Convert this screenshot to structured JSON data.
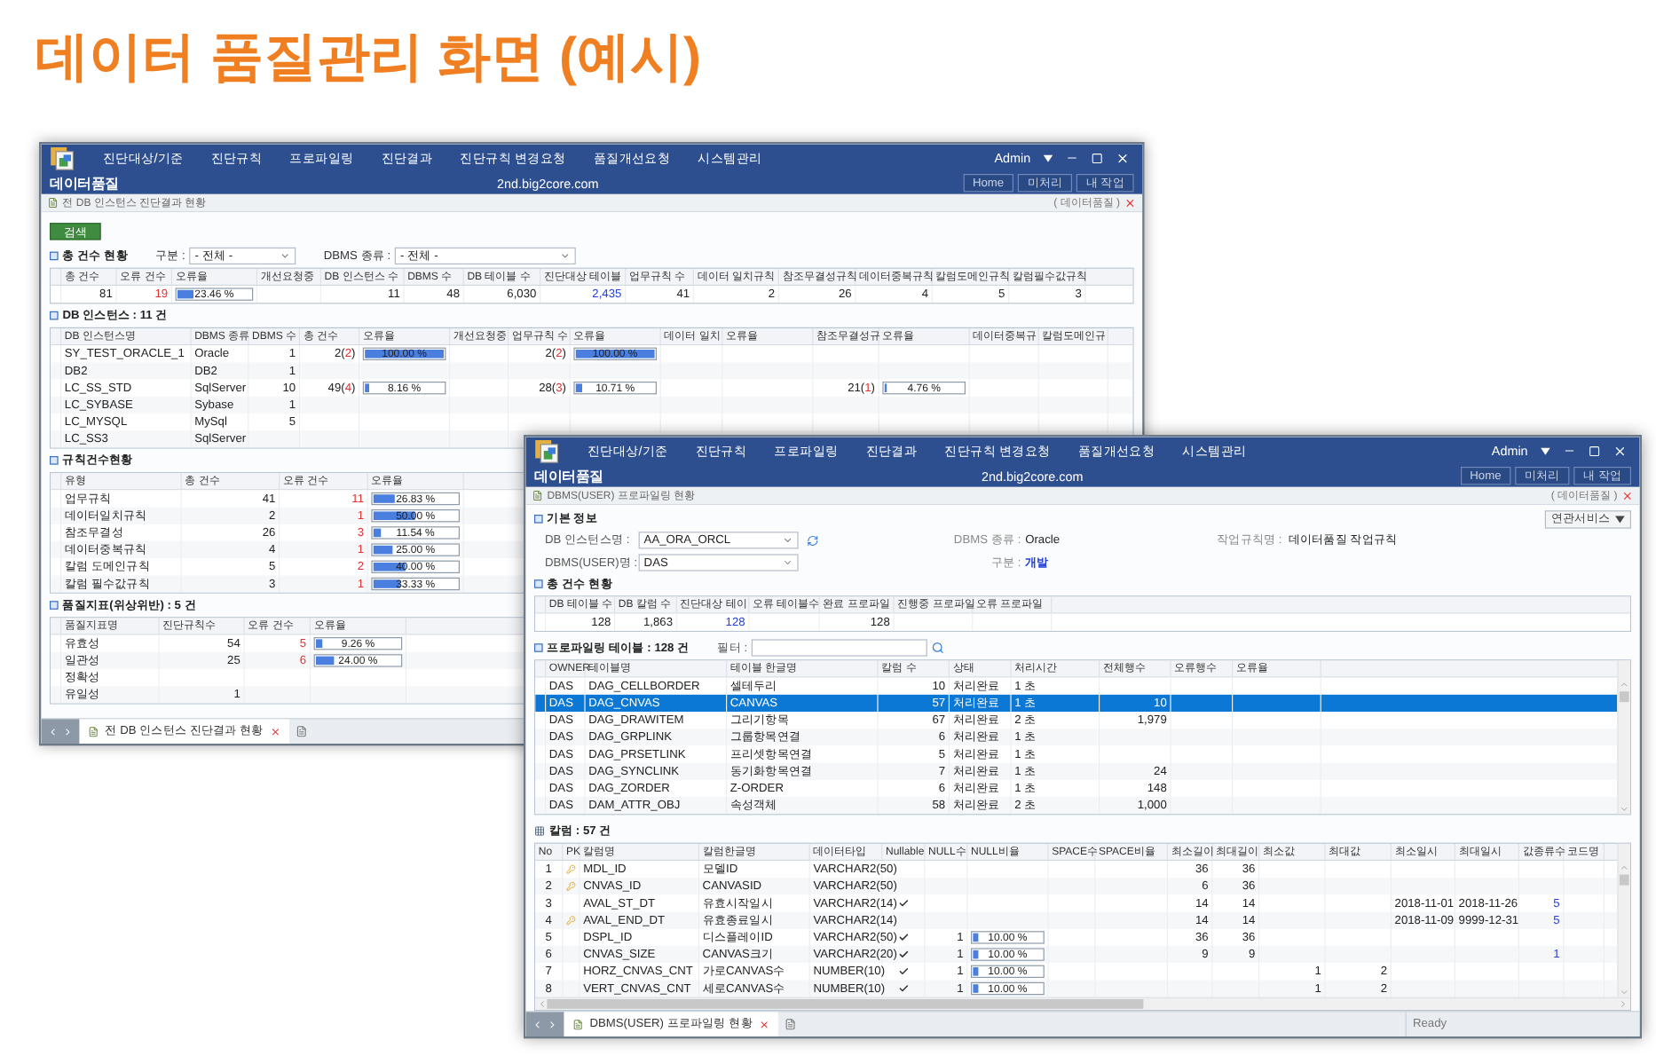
{
  "heading": "데이터 품질관리 화면 (예시)",
  "overview_window": {
    "menu": [
      "진단대상/기준",
      "진단규칙",
      "프로파일링",
      "진단결과",
      "진단규칙 변경요청",
      "품질개선요청",
      "시스템관리"
    ],
    "app_name": "데이터품질",
    "host": "2nd.big2core.com",
    "user": "Admin",
    "nav_buttons": [
      "Home",
      "미처리",
      "내 작업"
    ],
    "breadcrumb": "전 DB 인스턴스 진단결과 현황",
    "module": "( 데이터품질 )",
    "search_button": "검색",
    "summary": {
      "title": "총 건수 현황",
      "filters": [
        {
          "label": "구분 :",
          "value": "- 전체 -"
        },
        {
          "label": "DBMS 종류 :",
          "value": "- 전체 -"
        }
      ],
      "columns": [
        "총 건수",
        "오류 건수",
        "오류율",
        "개선요청중",
        "DB 인스턴스 수",
        "DBMS 수",
        "DB 테이블 수",
        "진단대상 테이블",
        "업무규칙 수",
        "데이터 일치규칙",
        "참조무결성규칙",
        "데이터중복규칙",
        "칼럼도메인규칙",
        "칼럼필수값규칙"
      ],
      "rows": [
        {
          "cells": [
            "81",
            {
              "kind": "red",
              "text": "19"
            },
            {
              "kind": "bar",
              "level": 0.2346,
              "text": "23.46 %"
            },
            "",
            "11",
            "48",
            "6,030",
            {
              "kind": "blue",
              "text": "2,435"
            },
            "41",
            "2",
            "26",
            "4",
            "5",
            "3"
          ]
        }
      ]
    },
    "instances": {
      "title": "DB 인스턴스 : 11 건",
      "columns": [
        "DB 인스턴스명",
        "DBMS 종류",
        "DBMS 수",
        "총 건수",
        "오류율",
        "개선요청중",
        "업무규칙 수",
        "오류율",
        "데이터 일치",
        "오류율",
        "참조무결성규",
        "오류율",
        "데이터중복규",
        "칼럼도메인규"
      ],
      "rows": [
        {
          "cells": [
            "SY_TEST_ORACLE_1",
            "Oracle",
            "1",
            {
              "kind": "pair",
              "parts": [
                "2(",
                "2",
                ")"
              ]
            },
            {
              "kind": "bar",
              "level": 1,
              "text": "100.00 %"
            },
            "",
            {
              "kind": "pair",
              "parts": [
                "2(",
                "2",
                ")"
              ]
            },
            {
              "kind": "bar",
              "level": 1,
              "text": "100.00 %"
            },
            "",
            "",
            "",
            "",
            "",
            ""
          ]
        },
        {
          "cells": [
            "DB2",
            "DB2",
            "1",
            "",
            "",
            "",
            "",
            "",
            "",
            "",
            "",
            "",
            "",
            ""
          ]
        },
        {
          "cells": [
            "LC_SS_STD",
            "SqlServer",
            "10",
            {
              "kind": "pair",
              "parts": [
                "49(",
                "4",
                ")"
              ]
            },
            {
              "kind": "bar",
              "level": 0.0816,
              "text": "8.16 %"
            },
            "",
            {
              "kind": "pair",
              "parts": [
                "28(",
                "3",
                ")"
              ]
            },
            {
              "kind": "bar",
              "level": 0.1071,
              "text": "10.71 %"
            },
            "",
            "",
            {
              "kind": "pair",
              "parts": [
                "21(",
                "1",
                ")"
              ]
            },
            {
              "kind": "bar",
              "level": 0.0476,
              "text": "4.76 %"
            },
            "",
            ""
          ]
        },
        {
          "cells": [
            "LC_SYBASE",
            "Sybase",
            "1",
            "",
            "",
            "",
            "",
            "",
            "",
            "",
            "",
            "",
            "",
            ""
          ]
        },
        {
          "cells": [
            "LC_MYSQL",
            "MySql",
            "5",
            "",
            "",
            "",
            "",
            "",
            "",
            "",
            "",
            "",
            "",
            ""
          ]
        },
        {
          "cells": [
            "LC_SS3",
            "SqlServer",
            "",
            "",
            "",
            "",
            "",
            "",
            "",
            "",
            "",
            "",
            "",
            ""
          ]
        }
      ]
    },
    "rules": {
      "title": "규칙건수현황",
      "columns": [
        "유형",
        "총 건수",
        "오류 건수",
        "오류율"
      ],
      "rows": [
        {
          "cells": [
            "업무규칙",
            "41",
            {
              "kind": "red",
              "text": "11"
            },
            {
              "kind": "bar",
              "level": 0.2683,
              "text": "26.83 %"
            }
          ]
        },
        {
          "cells": [
            "데이터일치규칙",
            "2",
            {
              "kind": "red",
              "text": "1"
            },
            {
              "kind": "bar",
              "level": 0.5,
              "text": "50.00 %"
            }
          ]
        },
        {
          "cells": [
            "참조무결성",
            "26",
            {
              "kind": "red",
              "text": "3"
            },
            {
              "kind": "bar",
              "level": 0.1154,
              "text": "11.54 %"
            }
          ]
        },
        {
          "cells": [
            "데이터중복규칙",
            "4",
            {
              "kind": "red",
              "text": "1"
            },
            {
              "kind": "bar",
              "level": 0.25,
              "text": "25.00 %"
            }
          ]
        },
        {
          "cells": [
            "칼럼 도메인규칙",
            "5",
            {
              "kind": "red",
              "text": "2"
            },
            {
              "kind": "bar",
              "level": 0.4,
              "text": "40.00 %"
            }
          ]
        },
        {
          "cells": [
            "칼럼 필수값규칙",
            "3",
            {
              "kind": "red",
              "text": "1"
            },
            {
              "kind": "bar",
              "level": 0.3333,
              "text": "33.33 %"
            }
          ]
        }
      ]
    },
    "quality": {
      "title": "품질지표(위상위반) : 5 건",
      "columns": [
        "품질지표명",
        "진단규칙수",
        "오류 건수",
        "오류율"
      ],
      "rows": [
        {
          "cells": [
            "유효성",
            "54",
            {
              "kind": "red",
              "text": "5"
            },
            {
              "kind": "bar",
              "level": 0.0926,
              "text": "9.26 %"
            }
          ]
        },
        {
          "cells": [
            "일관성",
            "25",
            {
              "kind": "red",
              "text": "6"
            },
            {
              "kind": "bar",
              "level": 0.24,
              "text": "24.00 %"
            }
          ]
        },
        {
          "cells": [
            "정확성",
            "",
            "",
            ""
          ]
        },
        {
          "cells": [
            "유일성",
            "1",
            "",
            ""
          ]
        }
      ]
    },
    "tabs": [
      {
        "label": "전 DB 인스턴스 진단결과 현황",
        "selected": true
      }
    ]
  },
  "profiling_window": {
    "menu": [
      "진단대상/기준",
      "진단규칙",
      "프로파일링",
      "진단결과",
      "진단규칙 변경요청",
      "품질개선요청",
      "시스템관리"
    ],
    "app_name": "데이터품질",
    "host": "2nd.big2core.com",
    "user": "Admin",
    "nav_buttons": [
      "Home",
      "미처리",
      "내 작업"
    ],
    "breadcrumb": "DBMS(USER) 프로파일링 현황",
    "module": "( 데이터품질 )",
    "related_button": "연관서비스",
    "basic": {
      "title": "기본 정보",
      "instance": {
        "label": "DB 인스턴스명 :",
        "value": "AA_ORA_ORCL"
      },
      "dbms_type": {
        "label": "DBMS 종류 :",
        "value": "Oracle"
      },
      "rule": {
        "label": "작업규칙명 :",
        "value": "데이터품질 작업규칙"
      },
      "user_select": {
        "label": "DBMS(USER)명 :",
        "value": "DAS"
      },
      "category": {
        "label": "구분 :",
        "value": "개발"
      }
    },
    "summary": {
      "title": "총 건수 현황",
      "columns": [
        "DB 테이블 수",
        "DB 칼럼 수",
        "진단대상 테이",
        "오류 테이블수",
        "완료 프로파일",
        "진행중 프로파일",
        "오류 프로파일"
      ],
      "rows": [
        {
          "cells": [
            "128",
            "1,863",
            {
              "kind": "blue",
              "text": "128"
            },
            "",
            "128",
            "",
            ""
          ]
        }
      ]
    },
    "tables": {
      "title": "프로파일링 테이블 : 128 건",
      "filter_label": "필터 :",
      "columns": [
        "OWNER",
        "테이블명",
        "테이블 한글명",
        "칼럼 수",
        "상태",
        "처리시간",
        "전체행수",
        "오류행수",
        "오류율"
      ],
      "rows": [
        {
          "selected": false,
          "cells": [
            "DAS",
            "DAG_CELLBORDER",
            "셀테두리",
            "10",
            "처리완료",
            "1 초",
            "",
            "",
            ""
          ]
        },
        {
          "selected": true,
          "cells": [
            "DAS",
            "DAG_CNVAS",
            "CANVAS",
            "57",
            "처리완료",
            "1 초",
            "10",
            "",
            ""
          ]
        },
        {
          "selected": false,
          "cells": [
            "DAS",
            "DAG_DRAWITEM",
            "그리기항목",
            "67",
            "처리완료",
            "2 초",
            "1,979",
            "",
            ""
          ]
        },
        {
          "selected": false,
          "cells": [
            "DAS",
            "DAG_GRPLINK",
            "그룹항목연결",
            "6",
            "처리완료",
            "1 초",
            "",
            "",
            ""
          ]
        },
        {
          "selected": false,
          "cells": [
            "DAS",
            "DAG_PRSETLINK",
            "프리셋항목연결",
            "5",
            "처리완료",
            "1 초",
            "",
            "",
            ""
          ]
        },
        {
          "selected": false,
          "cells": [
            "DAS",
            "DAG_SYNCLINK",
            "동기화항목연결",
            "7",
            "처리완료",
            "1 초",
            "24",
            "",
            ""
          ]
        },
        {
          "selected": false,
          "cells": [
            "DAS",
            "DAG_ZORDER",
            "Z-ORDER",
            "6",
            "처리완료",
            "1 초",
            "148",
            "",
            ""
          ]
        },
        {
          "selected": false,
          "cells": [
            "DAS",
            "DAM_ATTR_OBJ",
            "속성객체",
            "58",
            "처리완료",
            "2 초",
            "1,000",
            "",
            ""
          ]
        }
      ]
    },
    "columns_table": {
      "title": "칼럼 : 57 건",
      "columns": [
        "No",
        "PK",
        "칼럼명",
        "칼럼한글명",
        "데이터타입",
        "Nullable",
        "NULL수",
        "NULL비율",
        "SPACE수",
        "SPACE비율",
        "최소길이",
        "최대길이",
        "최소값",
        "최대값",
        "최소일시",
        "최대일시",
        "값종류수",
        "코드명"
      ],
      "rows": [
        {
          "cells": [
            "1",
            {
              "kind": "key"
            },
            "MDL_ID",
            "모델ID",
            "VARCHAR2(50)",
            "",
            "",
            "",
            "",
            "",
            "36",
            "36",
            "",
            "",
            "",
            "",
            "",
            ""
          ]
        },
        {
          "cells": [
            "2",
            {
              "kind": "key"
            },
            "CNVAS_ID",
            "CANVASID",
            "VARCHAR2(50)",
            "",
            "",
            "",
            "",
            "",
            "6",
            "36",
            "",
            "",
            "",
            "",
            "",
            ""
          ]
        },
        {
          "cells": [
            "3",
            "",
            "AVAL_ST_DT",
            "유효시작일시",
            "VARCHAR2(14)",
            {
              "kind": "check"
            },
            "",
            "",
            "",
            "",
            "14",
            "14",
            "",
            "",
            "2018-11-01",
            "2018-11-26",
            {
              "kind": "blue",
              "text": "5"
            },
            ""
          ]
        },
        {
          "cells": [
            "4",
            {
              "kind": "key"
            },
            "AVAL_END_DT",
            "유효종료일시",
            "VARCHAR2(14)",
            "",
            "",
            "",
            "",
            "",
            "14",
            "14",
            "",
            "",
            "2018-11-09",
            "9999-12-31",
            {
              "kind": "blue",
              "text": "5"
            },
            ""
          ]
        },
        {
          "cells": [
            "5",
            "",
            "DSPL_ID",
            "디스플레이ID",
            "VARCHAR2(50)",
            {
              "kind": "check"
            },
            "1",
            {
              "kind": "bar",
              "level": 0.1,
              "text": "10.00 %"
            },
            "",
            "",
            "36",
            "36",
            "",
            "",
            "",
            "",
            "",
            ""
          ]
        },
        {
          "cells": [
            "6",
            "",
            "CNVAS_SIZE",
            "CANVAS크기",
            "VARCHAR2(20)",
            {
              "kind": "check"
            },
            "1",
            {
              "kind": "bar",
              "level": 0.1,
              "text": "10.00 %"
            },
            "",
            "",
            "9",
            "9",
            "",
            "",
            "",
            "",
            {
              "kind": "blue",
              "text": "1"
            },
            ""
          ]
        },
        {
          "cells": [
            "7",
            "",
            "HORZ_CNVAS_CNT",
            "가로CANVAS수",
            "NUMBER(10)",
            {
              "kind": "check"
            },
            "1",
            {
              "kind": "bar",
              "level": 0.1,
              "text": "10.00 %"
            },
            "",
            "",
            "",
            "",
            "1",
            "2",
            "",
            "",
            "",
            ""
          ]
        },
        {
          "cells": [
            "8",
            "",
            "VERT_CNVAS_CNT",
            "세로CANVAS수",
            "NUMBER(10)",
            {
              "kind": "check"
            },
            "1",
            {
              "kind": "bar",
              "level": 0.1,
              "text": "10.00 %"
            },
            "",
            "",
            "",
            "",
            "1",
            "2",
            "",
            "",
            "",
            ""
          ]
        }
      ]
    },
    "tabs": [
      {
        "label": "DBMS(USER) 프로파일링 현황",
        "selected": true
      }
    ],
    "status": "Ready"
  }
}
